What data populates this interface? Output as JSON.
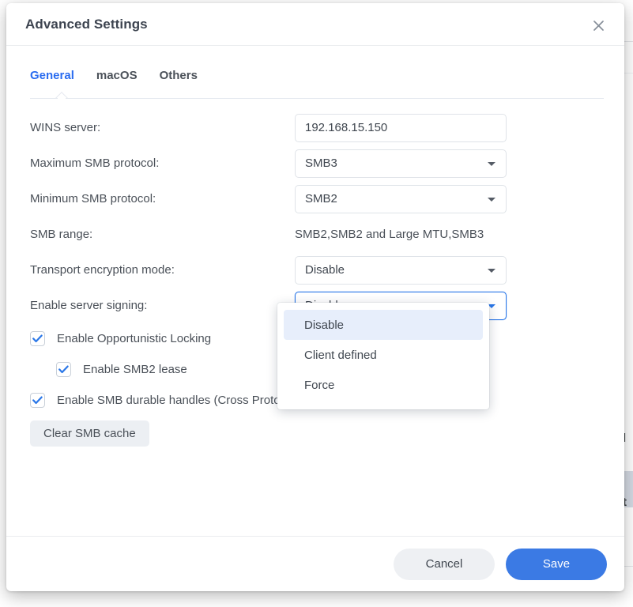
{
  "dialog": {
    "title": "Advanced Settings",
    "close_icon": "close-icon"
  },
  "tabs": [
    {
      "label": "General",
      "active": true
    },
    {
      "label": "macOS",
      "active": false
    },
    {
      "label": "Others",
      "active": false
    }
  ],
  "form": {
    "wins_server": {
      "label": "WINS server:",
      "value": "192.168.15.150",
      "placeholder": ""
    },
    "maximum_smb_protocol": {
      "label": "Maximum SMB protocol:",
      "value": "SMB3"
    },
    "minimum_smb_protocol": {
      "label": "Minimum SMB protocol:",
      "value": "SMB2"
    },
    "smb_range": {
      "label": "SMB range:",
      "value": "SMB2,SMB2 and Large MTU,SMB3"
    },
    "transport_encryption_mode": {
      "label": "Transport encryption mode:",
      "value": "Disable"
    },
    "enable_server_signing": {
      "label": "Enable server signing:",
      "value": "Disable",
      "focused": true,
      "options": [
        "Disable",
        "Client defined",
        "Force"
      ],
      "highlighted_option": "Disable"
    }
  },
  "checkboxes": [
    {
      "label": "Enable Opportunistic Locking",
      "checked": true,
      "indent": false
    },
    {
      "label": "Enable SMB2 lease",
      "checked": true,
      "indent": true
    },
    {
      "label": "Enable SMB durable handles (Cross Protocol Lock will be disabled)",
      "checked": true,
      "indent": false
    }
  ],
  "buttons": {
    "clear_cache": "Clear SMB cache",
    "cancel": "Cancel",
    "save": "Save"
  },
  "background": {
    "text_fragment_1": "l",
    "text_fragment_2": "t"
  },
  "colors": {
    "accent": "#2a6cf0",
    "save_button": "#3b7ae4",
    "checkbox_check": "#2a77e8",
    "focus_border": "#2a77e8",
    "highlight_row": "#e7eefb",
    "label_text": "#4a5058"
  }
}
